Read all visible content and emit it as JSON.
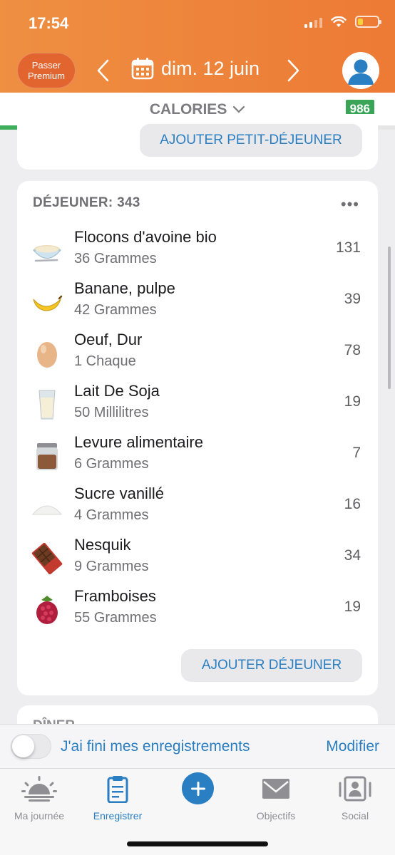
{
  "status": {
    "time": "17:54"
  },
  "header": {
    "premium_line1": "Passer",
    "premium_line2": "Premium",
    "date": "dim. 12 juin"
  },
  "calories": {
    "label": "CALORIES",
    "remaining": "986",
    "progress": 0.215
  },
  "breakfast": {
    "add_label": "AJOUTER PETIT-DÉJEUNER"
  },
  "lunch": {
    "title": "DÉJEUNER: 343",
    "more": "•••",
    "add_label": "AJOUTER DÉJEUNER",
    "items": [
      {
        "name": "Flocons d'avoine bio",
        "qty": "36 Grammes",
        "cal": "131",
        "icon": "oat-bowl-icon"
      },
      {
        "name": "Banane, pulpe",
        "qty": "42 Grammes",
        "cal": "39",
        "icon": "banana-icon"
      },
      {
        "name": "Oeuf, Dur",
        "qty": "1 Chaque",
        "cal": "78",
        "icon": "egg-icon"
      },
      {
        "name": "Lait De Soja",
        "qty": "50 Millilitres",
        "cal": "19",
        "icon": "milk-glass-icon"
      },
      {
        "name": "Levure alimentaire",
        "qty": "6 Grammes",
        "cal": "7",
        "icon": "jar-icon"
      },
      {
        "name": "Sucre vanillé",
        "qty": "4 Grammes",
        "cal": "16",
        "icon": "sugar-icon"
      },
      {
        "name": "Nesquik",
        "qty": "9 Grammes",
        "cal": "34",
        "icon": "chocolate-icon"
      },
      {
        "name": "Framboises",
        "qty": "55 Grammes",
        "cal": "19",
        "icon": "raspberry-icon"
      }
    ]
  },
  "dinner": {
    "title": "DÎNER"
  },
  "bottom": {
    "done_label": "J'ai fini mes enregistrements",
    "edit_label": "Modifier"
  },
  "tabs": [
    {
      "label": "Ma journée",
      "icon": "sunrise-icon"
    },
    {
      "label": "Enregistrer",
      "icon": "clipboard-icon"
    },
    {
      "label": "",
      "icon": "plus-icon"
    },
    {
      "label": "Objectifs",
      "icon": "envelope-icon"
    },
    {
      "label": "Social",
      "icon": "social-icon"
    }
  ],
  "colors": {
    "accent": "#ed7a35",
    "link": "#2a7ec2",
    "badge": "#3aa556"
  }
}
